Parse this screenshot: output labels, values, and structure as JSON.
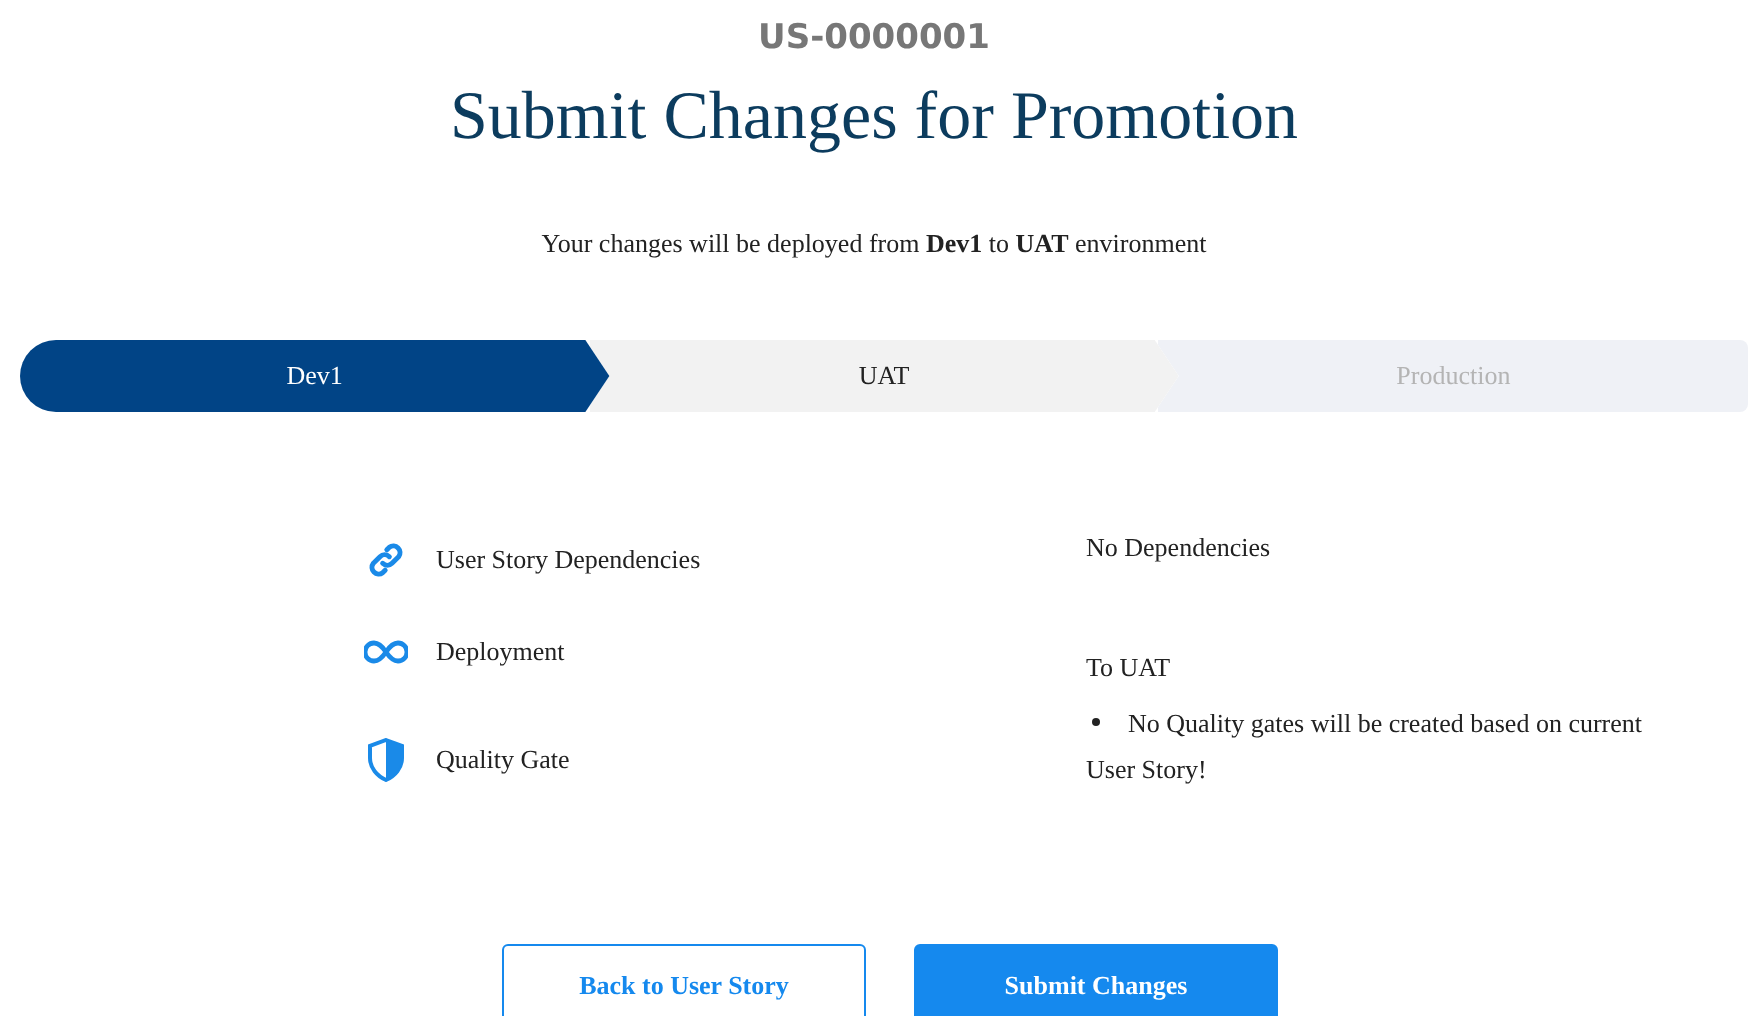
{
  "record_id": "US-0000001",
  "title": "Submit Changes for Promotion",
  "subtitle": "Your changes will be deployed from **Dev1** to **UAT** environment",
  "stages": [
    {
      "label": "Dev1",
      "selected": true,
      "disabled": false
    },
    {
      "label": "UAT",
      "selected": false,
      "disabled": false
    },
    {
      "label": "Production",
      "selected": false,
      "disabled": true
    }
  ],
  "details": [
    {
      "label": "User Story Dependencies",
      "kind": "link"
    },
    {
      "label": "Deployment",
      "kind": "infinity"
    },
    {
      "label": "Quality Gate",
      "kind": "shield"
    }
  ],
  "dependencies_text": "No Dependencies",
  "deployment_text": "To UAT",
  "quality_gate_notes": [
    "No Quality gates will be created based on current User Story!"
  ],
  "buttons": [
    {
      "label": "Back to User Story",
      "kind": "secondary"
    },
    {
      "label": "Submit Changes",
      "kind": "primary"
    }
  ]
}
